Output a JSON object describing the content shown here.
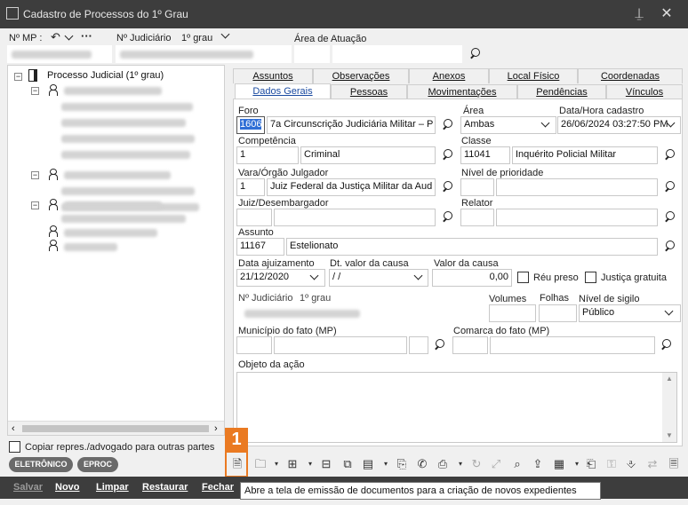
{
  "window": {
    "title": "Cadastro de Processos do 1º Grau"
  },
  "header": {
    "nmp_label": "Nº MP :",
    "njud_label": "Nº Judiciário",
    "njud_grade": "1º grau",
    "area_label": "Área de Atuação"
  },
  "tree": {
    "root_label": "Processo Judicial (1º grau)"
  },
  "tabs_top": [
    "Assuntos",
    "Observações",
    "Anexos",
    "Local Físico",
    "Coordenadas"
  ],
  "tabs_bottom": [
    "Dados Gerais",
    "Pessoas",
    "Movimentações",
    "Pendências",
    "Vínculos"
  ],
  "form": {
    "foro_label": "Foro",
    "foro_code": "1606",
    "foro_name": "7a Circunscrição Judiciária Militar – P",
    "area_label": "Área",
    "area_value": "Ambas",
    "dt_cad_label": "Data/Hora cadastro",
    "dt_cad_value": "26/06/2024 03:27:50 PM",
    "competencia_label": "Competência",
    "competencia_code": "1",
    "competencia_name": "Criminal",
    "classe_label": "Classe",
    "classe_code": "11041",
    "classe_name": "Inquérito Policial Militar",
    "vara_label": "Vara/Órgão Julgador",
    "vara_code": "1",
    "vara_name": "Juiz Federal da Justiça Militar da Aud",
    "prioridade_label": "Nível de prioridade",
    "juiz_label": "Juiz/Desembargador",
    "relator_label": "Relator",
    "assunto_label": "Assunto",
    "assunto_code": "11167",
    "assunto_name": "Estelionato",
    "dt_ajuiz_label": "Data ajuizamento",
    "dt_ajuiz_value": "21/12/2020",
    "dt_valor_label": "Dt. valor da causa",
    "dt_valor_value": " / /",
    "valor_label": "Valor da causa",
    "valor_value": "0,00",
    "reu_preso_label": "Réu preso",
    "justica_gratuita_label": "Justiça gratuita",
    "njud_label": "Nº Judiciário",
    "njud_grade": "1º grau",
    "volumes_label": "Volumes",
    "folhas_label": "Folhas",
    "sigilo_label": "Nível de sigilo",
    "sigilo_value": "Público",
    "municipio_label": "Município do fato (MP)",
    "comarca_label": "Comarca do fato (MP)",
    "objeto_label": "Objeto da ação"
  },
  "left_bottom": {
    "copiar_label": "Copiar repres./advogado para outras partes",
    "eletronico": "ELETRÔNICO",
    "eproc": "EPROC"
  },
  "callout": {
    "number": "1"
  },
  "actions": {
    "salvar": "Salvar",
    "novo": "Novo",
    "limpar": "Limpar",
    "restaurar": "Restaurar",
    "fechar": "Fechar"
  },
  "tooltip": {
    "text": "Abre a tela de emissão de documentos para a criação de novos expedientes"
  },
  "colors": {
    "titlebar": "#3d3d3d",
    "accent": "#ea7a22",
    "tab_active_text": "#1a4aa0"
  }
}
